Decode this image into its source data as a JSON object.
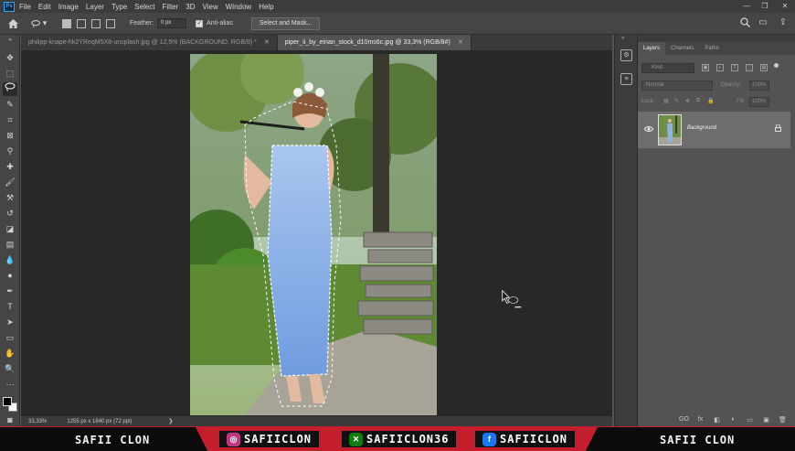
{
  "app": {
    "logo_text": "Ps",
    "menu": [
      "File",
      "Edit",
      "Image",
      "Layer",
      "Type",
      "Select",
      "Filter",
      "3D",
      "View",
      "Window",
      "Help"
    ],
    "window_controls": [
      "—",
      "❐",
      "✕"
    ]
  },
  "options_bar": {
    "home_icon": "home-icon",
    "tool_icon": "lasso-icon",
    "feather_label": "Feather:",
    "feather_value": "0 px",
    "antialias_label": "Anti-alias",
    "antialias_checked": true,
    "select_mask_label": "Select and Mask..."
  },
  "tabs": [
    {
      "label": "philipp-knape-hk2YReqM5X8-unsplash.jpg @ 12,5% (BACKGROUND, RGB/8) *",
      "active": false
    },
    {
      "label": "piper_ii_by_eirian_stock_d10ms6c.jpg @ 33,3% (RGB/8#)",
      "active": true
    }
  ],
  "status_bar": {
    "zoom": "33,33%",
    "doc_info": "1255 px x 1840 px (72 ppi)",
    "arrow": "❯"
  },
  "layers_panel": {
    "tabs": [
      "Layers",
      "Channels",
      "Paths"
    ],
    "active_tab": "Layers",
    "kind_label": "Kind",
    "blend_mode": "Normal",
    "opacity_label": "Opacity:",
    "opacity_value": "100%",
    "lock_label": "Lock:",
    "fill_label": "Fill:",
    "fill_value": "100%",
    "layers": [
      {
        "name": "Background",
        "visible": true,
        "locked": true
      }
    ],
    "bottom_icons": [
      "GO",
      "fx",
      "◧",
      "◐",
      "▭",
      "▣",
      "🗑"
    ]
  },
  "banner": {
    "left_brand": "SAFII CLON",
    "right_brand": "SAFII CLON",
    "socials": [
      {
        "network": "instagram",
        "handle": "SAFIICLON",
        "color": "#c13584"
      },
      {
        "network": "xbox",
        "handle": "SAFIICLON36",
        "color": "#107c10"
      },
      {
        "network": "facebook",
        "handle": "SAFIICLON",
        "color": "#1877f2"
      }
    ]
  },
  "colors": {
    "accent_red": "#c41d2c",
    "ps_blue": "#31a8ff",
    "panel_bg": "#535353",
    "dark_bg": "#282828"
  }
}
